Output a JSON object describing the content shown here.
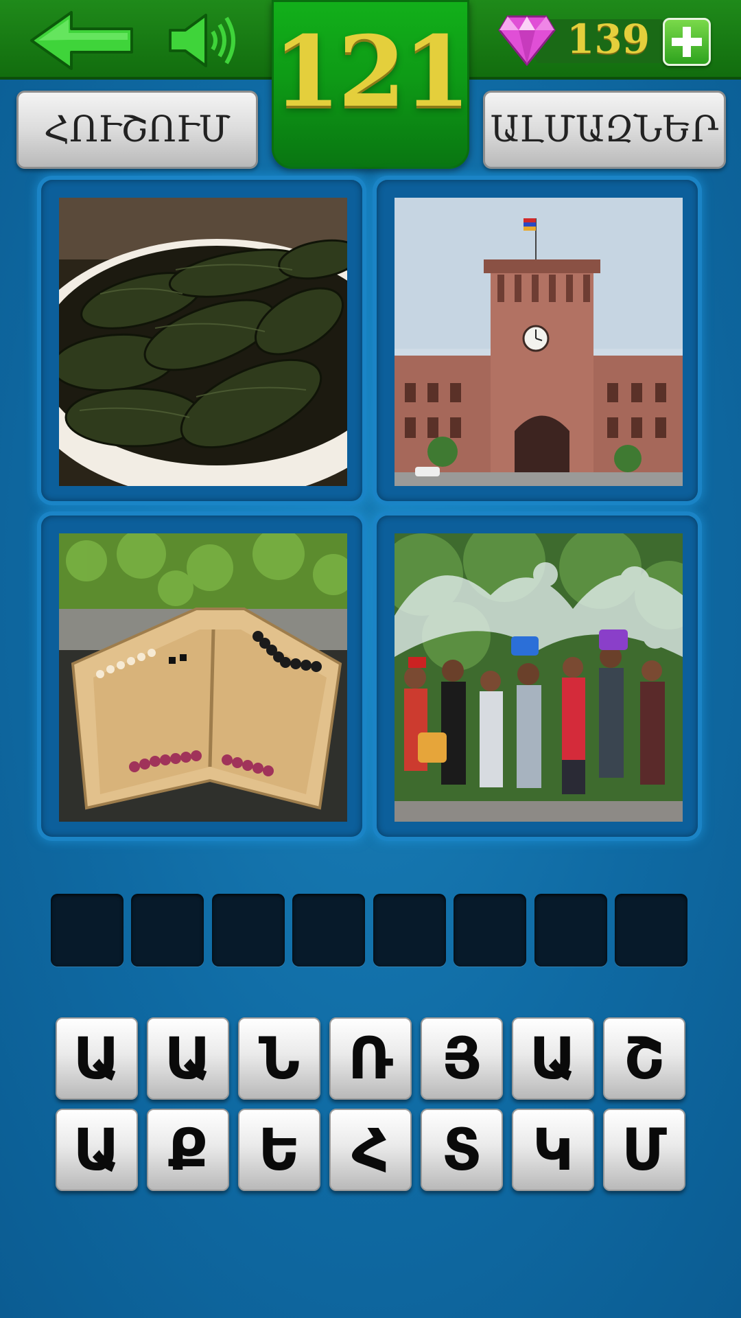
{
  "header": {
    "level": "121",
    "gem_count": "139",
    "icons": [
      "back-arrow-icon",
      "speaker-icon",
      "gem-icon",
      "plus-icon"
    ]
  },
  "buttons": {
    "hint_label": "ՀՈՒՇՈՒՄ",
    "gems_label": "ԱԼՄԱԶՆԵՐ"
  },
  "pictures": [
    {
      "subject": "dolma"
    },
    {
      "subject": "government-building"
    },
    {
      "subject": "backgammon-board"
    },
    {
      "subject": "water-festival"
    }
  ],
  "answer": {
    "slots": [
      "",
      "",
      "",
      "",
      "",
      "",
      "",
      ""
    ]
  },
  "keyboard": {
    "row1": [
      "Ա",
      "Ա",
      "Ն",
      "Ռ",
      "Յ",
      "Ա",
      "Շ"
    ],
    "row2": [
      "Ա",
      "Ք",
      "Ե",
      "Հ",
      "Տ",
      "Կ",
      "Մ"
    ]
  },
  "colors": {
    "header_green": "#1f8a1a",
    "level_yellow": "#e4cf3c",
    "background_blue": "#0f6aa3",
    "slot_dark": "#071a2a"
  }
}
